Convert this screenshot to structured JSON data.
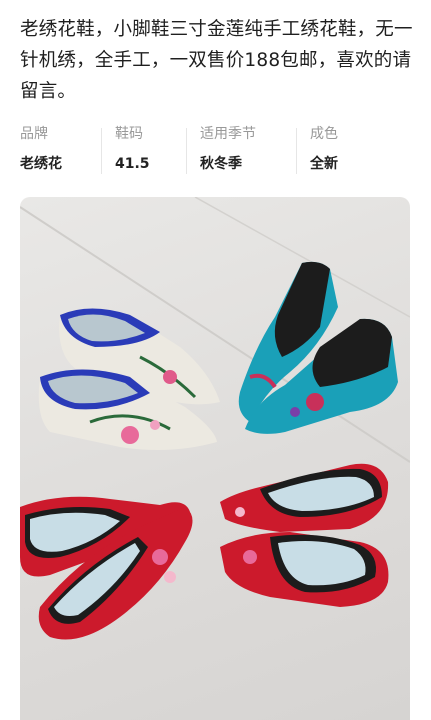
{
  "listing": {
    "description": "老绣花鞋，小脚鞋三寸金莲纯手工绣花鞋，无一针机绣，全手工，一双售价188包邮，喜欢的请留言。"
  },
  "attributes": [
    {
      "label": "品牌",
      "value": "老绣花"
    },
    {
      "label": "鞋码",
      "value": "41.5"
    },
    {
      "label": "适用季节",
      "value": "秋冬季"
    },
    {
      "label": "成色",
      "value": "全新"
    }
  ],
  "colors": {
    "shoe_white": "#e8e5dc",
    "shoe_blue_trim": "#2a3bb8",
    "shoe_teal": "#1a9bb0",
    "shoe_red": "#c8182a",
    "insole": "#cfe0e8"
  }
}
